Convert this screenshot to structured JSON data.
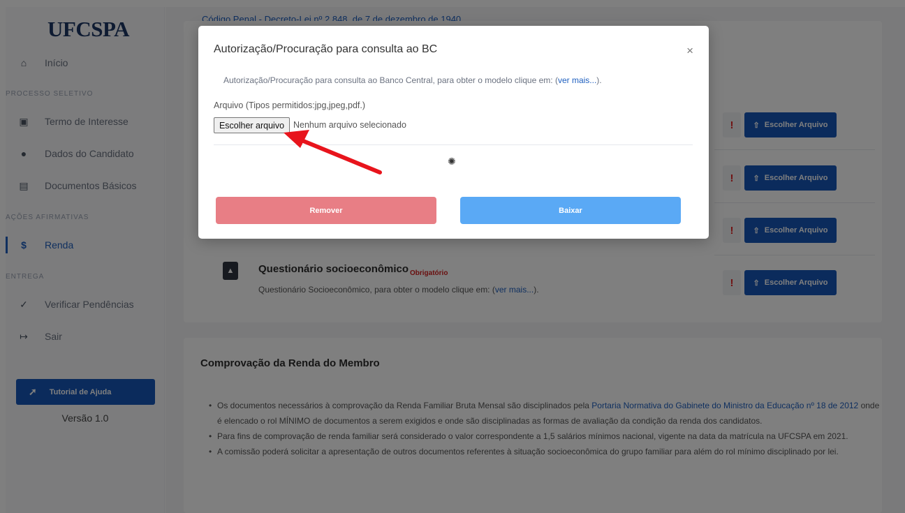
{
  "sidebar": {
    "logo": "UFCSPA",
    "items": [
      {
        "icon": "home-icon",
        "glyph": "⌂",
        "label": "Início"
      },
      {
        "icon": "printer-icon",
        "glyph": "▣",
        "label": "Termo de Interesse"
      },
      {
        "icon": "user-icon",
        "glyph": "●",
        "label": "Dados do Candidato"
      },
      {
        "icon": "file-icon",
        "glyph": "▤",
        "label": "Documentos Básicos"
      },
      {
        "icon": "dollar-icon",
        "glyph": "$",
        "label": "Renda"
      },
      {
        "icon": "check-icon",
        "glyph": "✓",
        "label": "Verificar Pendências"
      },
      {
        "icon": "sign-out-icon",
        "glyph": "↦",
        "label": "Sair"
      }
    ],
    "sections": [
      "PROCESSO SELETIVO",
      "AÇÕES AFIRMATIVAS",
      "ENTREGA"
    ],
    "tutorial_label": "Tutorial de Ajuda",
    "tutorial_glyph": "➚",
    "version": "Versão 1.0"
  },
  "main": {
    "top_link": "Código Penal - Decreto-Lei nº 2.848, de 7 de dezembro de 1940",
    "upload_label": "Escolher Arquivo",
    "upload_glyph": "⇧",
    "warn_glyph": "!",
    "questionario": {
      "title": "Questionário socioeconômico",
      "badge": "Obrigatório",
      "desc_prefix": "Questionário Socioeconômico, para obter o modelo clique em: (",
      "desc_link": "ver mais...",
      "desc_suffix": ")."
    },
    "renda": {
      "title": "Comprovação da Renda do Membro",
      "b1_pre": "Os documentos necessários à comprovação da Renda Familiar Bruta Mensal são disciplinados pela ",
      "b1_link": "Portaria Normativa do Gabinete do Ministro da Educação nº 18 de 2012",
      "b1_post": " onde é elencado o rol MÍNIMO de documentos a serem exigidos e onde são disciplinadas as formas de avaliação da condição da renda dos candidatos.",
      "b2": "Para fins de comprovação de renda familiar será considerado o valor correspondente a 1,5 salários mínimos nacional, vigente na data da matrícula na UFCSPA em 2021.",
      "b3": "A comissão poderá solicitar a apresentação de outros documentos referentes à situação socioeconômica do grupo familiar para além do rol mínimo disciplinado por lei."
    }
  },
  "modal": {
    "title": "Autorização/Procuração para consulta ao BC",
    "close": "×",
    "desc_prefix": "Autorização/Procuração para consulta ao Banco Central, para obter o modelo clique em: (",
    "desc_link": "ver mais...",
    "desc_suffix": ").",
    "file_label": "Arquivo (Tipos permitidos:jpg,jpeg,pdf.)",
    "file_button": "Escolher arquivo",
    "file_status": "Nenhum arquivo selecionado",
    "spinner": "✺",
    "remove_label": "Remover",
    "download_label": "Baixar"
  },
  "colors": {
    "primary": "#1757b8",
    "remove": "#e87e85",
    "download": "#5aa9f5",
    "annotation_arrow": "#e8141c"
  }
}
